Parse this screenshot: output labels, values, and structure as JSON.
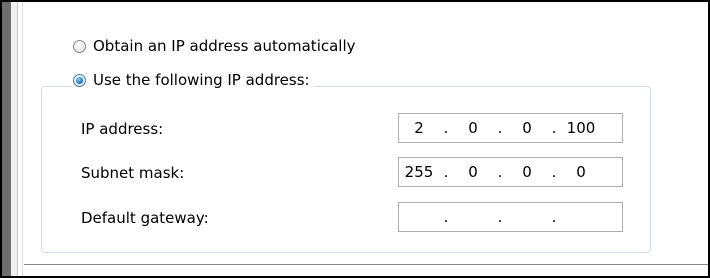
{
  "radio_auto": {
    "label": "Obtain an IP address automatically",
    "checked": false
  },
  "radio_manual": {
    "label": "Use the following IP address:",
    "checked": true
  },
  "fields": [
    {
      "label": "IP address:",
      "octets": [
        "2",
        "0",
        "0",
        "100"
      ]
    },
    {
      "label": "Subnet mask:",
      "octets": [
        "255",
        "0",
        "0",
        "0"
      ]
    },
    {
      "label": "Default gateway:",
      "octets": [
        "",
        "",
        "",
        ""
      ]
    }
  ],
  "separator": ".",
  "colors": {
    "left_bar": "#6e6e6e",
    "groupbox_border": "#d5dfe5",
    "input_border": "#abadb3",
    "radio_selected": "#2a7ac2"
  }
}
